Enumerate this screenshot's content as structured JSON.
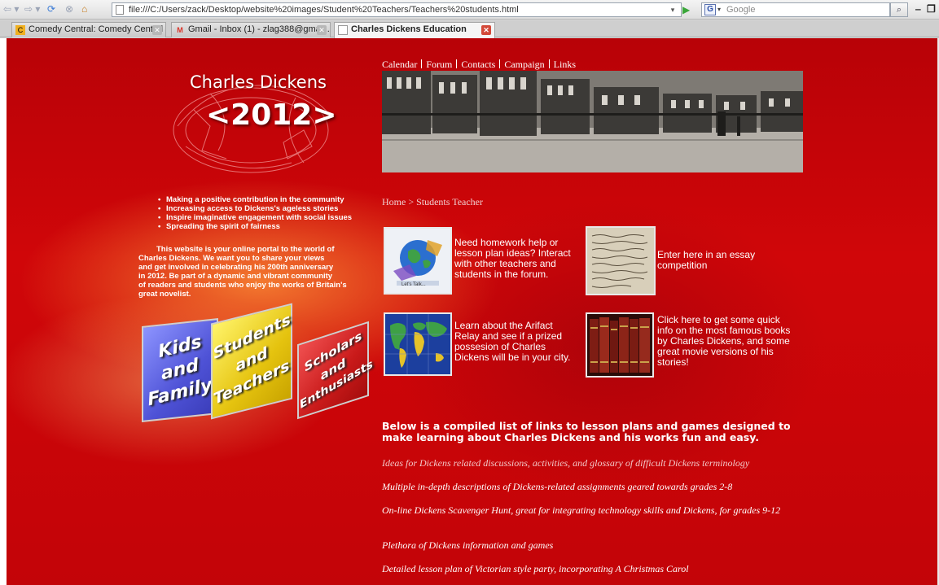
{
  "browser": {
    "url": "file:///C:/Users/zack/Desktop/website%20images/Student%20Teachers/Teachers%20students.html",
    "search_placeholder": "Google",
    "tabs": [
      {
        "label": "Comedy Central: Comedy Central S..."
      },
      {
        "label": "Gmail - Inbox (1) - zlag388@gmail...."
      },
      {
        "label": "Charles Dickens Education"
      }
    ]
  },
  "logo": {
    "title": "Charles Dickens",
    "year": "<2012>"
  },
  "top_nav": [
    "Calendar",
    "Forum",
    "Contacts",
    "Campaign",
    "Links"
  ],
  "mission_bullets": [
    "Making a positive contribution in the community",
    "Increasing access to Dickens's ageless stories",
    "Inspire imaginative engagement with social issues",
    "Spreading the spirit of fairness"
  ],
  "intro_lines": [
    "This website is your online portal to the world of",
    "Charles Dickens. We want you to share your views",
    "and get involved in celebrating his 200th anniversary",
    "in 2012.  Be part of a dynamic and vibrant community",
    "of readers and students who enjoy the works of Britain's",
    "great novelist."
  ],
  "audience_cards": {
    "kids": [
      "Kids",
      "and",
      "Family"
    ],
    "students": [
      "Students",
      "and",
      "Teachers"
    ],
    "scholars": [
      "Scholars",
      "and",
      "Enthusiasts"
    ]
  },
  "breadcrumb": "Home > Students Teacher",
  "features": {
    "forum": {
      "text": "Need homework help or lesson plan ideas? Interact with other teachers and students in the forum.",
      "thumb_caption": "Let's Talk..."
    },
    "essay": {
      "text": "Enter here in an essay competition"
    },
    "relay": {
      "text": "Learn about the Arifact Relay and see if a prized possesion of Charles Dickens will be in your city."
    },
    "books": {
      "text": "Click here to get some quick info on the most famous books by Charles Dickens, and some great movie versions of his stories!"
    }
  },
  "links_heading": "Below is a compiled list of links to lesson plans and games designed to make learning about Charles Dickens and his works fun and easy.",
  "lesson_links": [
    "Ideas for Dickens related discussions, activities, and glossary of difficult Dickens terminology",
    "Multiple in-depth descriptions of Dickens-related assignments geared towards grades 2-8",
    "On-line Dickens Scavenger Hunt, great for integrating technology skills and Dickens, for grades 9-12",
    "Plethora of Dickens information and games",
    "Detailed lesson plan of Victorian style party, incorporating A Christmas Carol"
  ],
  "colors": {
    "page_background": "#c70409",
    "text": "#ffffff",
    "kids_card": "#6a6ef0",
    "students_card": "#f2d22a",
    "scholars_card": "#d62a2a"
  }
}
